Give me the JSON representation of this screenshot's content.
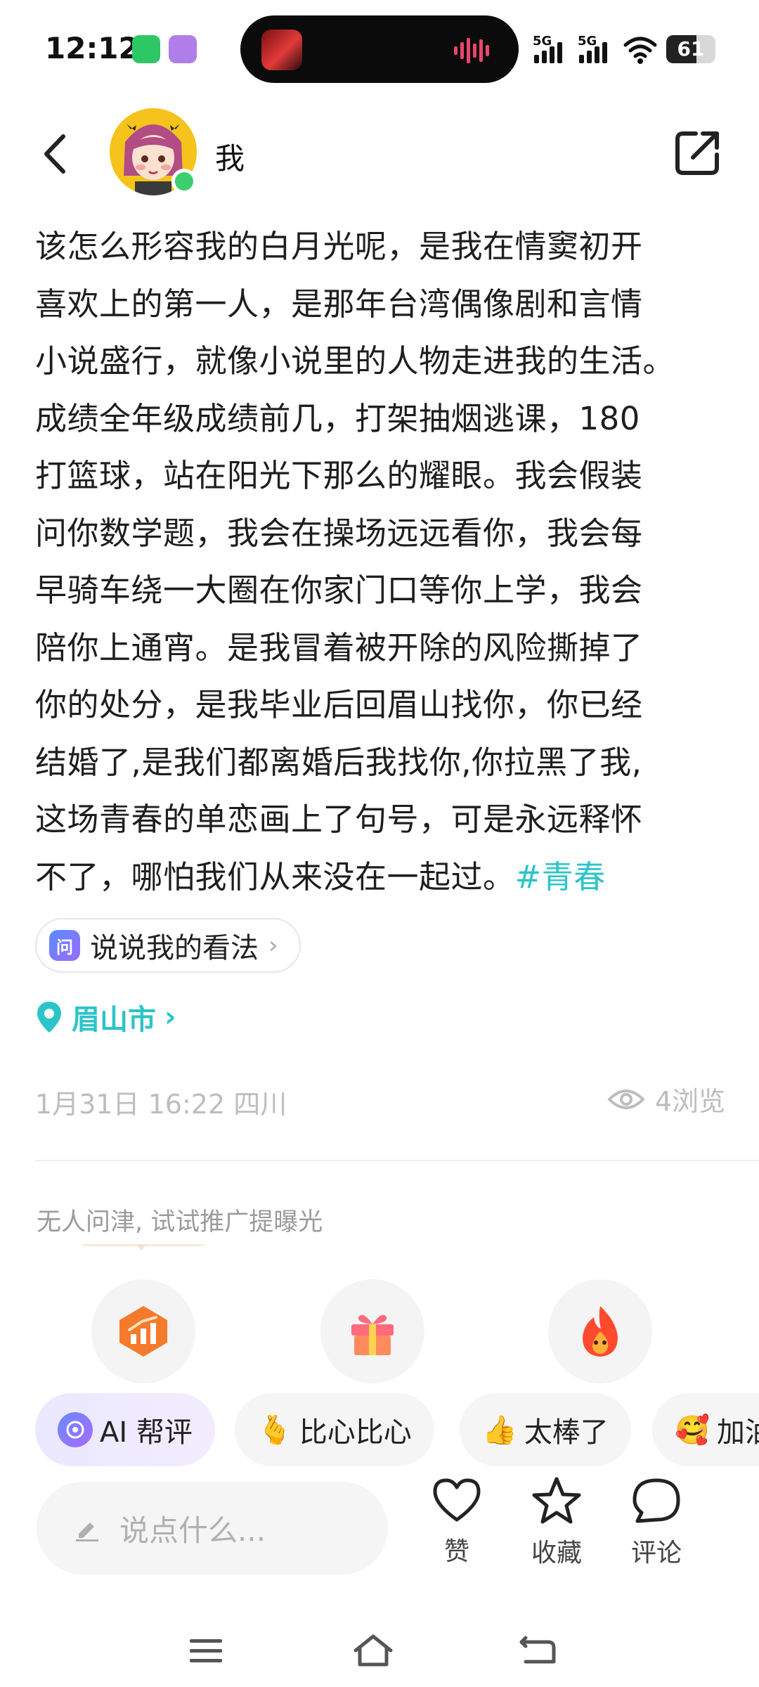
{
  "status_bar": {
    "time": "12:12",
    "network_1": "5G",
    "network_2": "5G",
    "battery": "61",
    "battery_level": 0.61,
    "icons": [
      "wechat-icon",
      "app-notification-icon",
      "music-waveform-icon",
      "signal-icon",
      "wifi-icon",
      "battery-icon"
    ]
  },
  "header": {
    "username": "我",
    "icons": [
      "back-icon",
      "avatar",
      "share-icon"
    ]
  },
  "post": {
    "lines": [
      "该怎么形容我的白月光呢，是我在情窦初开",
      "喜欢上的第一人，是那年台湾偶像剧和言情",
      "小说盛行，就像小说里的人物走进我的生活。",
      "成绩全年级成绩前几，打架抽烟逃课，180",
      "打篮球，站在阳光下那么的耀眼。我会假装",
      "问你数学题，我会在操场远远看你，我会每",
      "早骑车绕一大圈在你家门口等你上学，我会",
      "陪你上通宵。是我冒着被开除的风险撕掉了",
      "你的处分，是我毕业后回眉山找你，你已经",
      "结婚了,是我们都离婚后我找你,你拉黑了我,",
      "这场青春的单恋画上了句号，可是永远释怀",
      "不了，哪怕我们从来没在一起过。"
    ],
    "hashtag": "#青春",
    "ask_chip": {
      "icon_text": "问",
      "label": "说说我的看法"
    },
    "location": "眉山市",
    "meta": "1月31日 16:22 四川",
    "views": "4浏览"
  },
  "promo": {
    "hint": "无人问津, 试试推广提曝光",
    "icons": [
      "boost-chart-icon",
      "gift-icon",
      "fire-icon"
    ]
  },
  "reactions": [
    {
      "emoji": "",
      "label": "AI 帮评"
    },
    {
      "emoji": "🫰",
      "label": "比心比心"
    },
    {
      "emoji": "👍",
      "label": "太棒了"
    },
    {
      "emoji": "🥰",
      "label": "加油"
    }
  ],
  "bottom_bar": {
    "comment_placeholder": "说点什么...",
    "like_label": "赞",
    "collect_label": "收藏",
    "comment_label": "评论"
  },
  "colors": {
    "accent_teal": "#2bc4c8",
    "online_green": "#3ccf6e",
    "muted_text": "#bdbdbd"
  }
}
